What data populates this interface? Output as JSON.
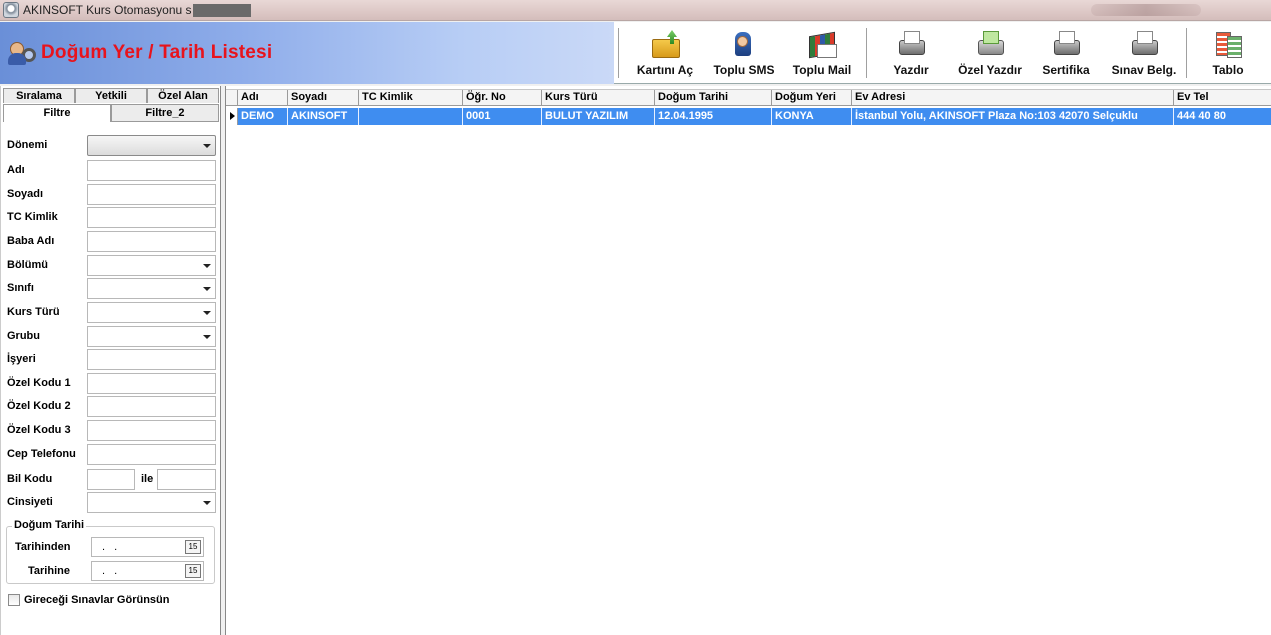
{
  "window": {
    "title": "AKINSOFT Kurs Otomasyonu s"
  },
  "header": {
    "page_title": "Doğum Yer / Tarih Listesi"
  },
  "toolbar": {
    "items": [
      {
        "label": "Kartını Aç",
        "icon": "folder-open-icon"
      },
      {
        "label": "Toplu SMS",
        "icon": "mobile-sms-icon"
      },
      {
        "label": "Toplu Mail",
        "icon": "mail-icon"
      },
      {
        "label": "Yazdır",
        "icon": "printer-icon"
      },
      {
        "label": "Özel Yazdır",
        "icon": "custom-print-icon"
      },
      {
        "label": "Sertifika",
        "icon": "certificate-print-icon"
      },
      {
        "label": "Sınav Belg.",
        "icon": "exam-document-icon"
      },
      {
        "label": "Tablo",
        "icon": "table-icon"
      }
    ]
  },
  "filter_panel": {
    "tabs_row1": [
      "Sıralama",
      "Yetkili",
      "Özel Alan"
    ],
    "tabs_row2": [
      "Filtre",
      "Filtre_2"
    ],
    "active_tab": "Filtre",
    "fields": {
      "donemi": "Dönemi",
      "adi": "Adı",
      "soyadi": "Soyadı",
      "tc_kimlik": "TC Kimlik",
      "baba_adi": "Baba Adı",
      "bolumu": "Bölümü",
      "sinifi": "Sınıfı",
      "kurs_turu": "Kurs Türü",
      "grubu": "Grubu",
      "isyeri": "İşyeri",
      "ozel_kodu_1": "Özel Kodu 1",
      "ozel_kodu_2": "Özel Kodu 2",
      "ozel_kodu_3": "Özel Kodu 3",
      "cep_telefonu": "Cep Telefonu",
      "bil_kodu": "Bil Kodu",
      "ile": "ile",
      "cinsiyeti": "Cinsiyeti"
    },
    "birth_group": {
      "legend": "Doğum Tarihi",
      "from_label": "Tarihinden",
      "to_label": "Tarihine",
      "from_value": ". .",
      "to_value": ". .",
      "calendar_glyph": "15"
    },
    "checkbox_label": "Gireceği Sınavlar Görünsün"
  },
  "grid": {
    "columns": [
      "Adı",
      "Soyadı",
      "TC Kimlik",
      "Öğr. No",
      "Kurs Türü",
      "Doğum Tarihi",
      "Doğum Yeri",
      "Ev Adresi",
      "Ev Tel"
    ],
    "rows": [
      [
        "DEMO",
        "AKINSOFT",
        "",
        "0001",
        "BULUT YAZILIM",
        "12.04.1995",
        "KONYA",
        "İstanbul Yolu, AKINSOFT Plaza No:103 42070 Selçuklu",
        "444 40 80"
      ]
    ]
  },
  "colors": {
    "title_red": "#e8131c",
    "selection_blue": "#3f8df0"
  }
}
